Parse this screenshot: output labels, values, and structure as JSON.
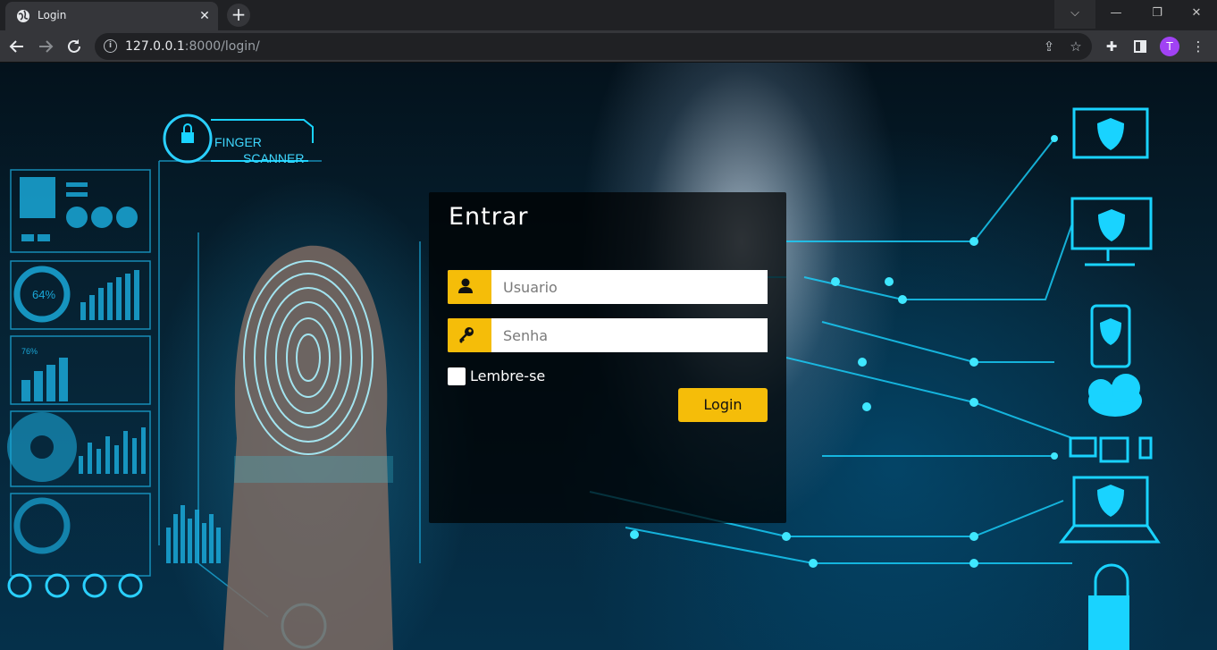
{
  "browser": {
    "tab_title": "Login",
    "new_tab_symbol": "+",
    "tab_close_symbol": "✕",
    "url_host": "127.0.0.1",
    "url_rest": ":8000/login/",
    "profile_initial": "T",
    "window_controls": {
      "dropdown": "⌵",
      "minimize": "—",
      "restore": "❐",
      "close": "✕"
    }
  },
  "background": {
    "finger_scanner_label_1": "FINGER",
    "finger_scanner_label_2": "SCANNER",
    "gauge_percent": "64%",
    "small_gauge_percent": "76%"
  },
  "login": {
    "title": "Entrar",
    "username_placeholder": "Usuario",
    "password_placeholder": "Senha",
    "remember_label": "Lembre-se",
    "submit_label": "Login"
  },
  "colors": {
    "accent": "#f5bd09",
    "panel": "#000000",
    "neon": "#19d3ff"
  }
}
